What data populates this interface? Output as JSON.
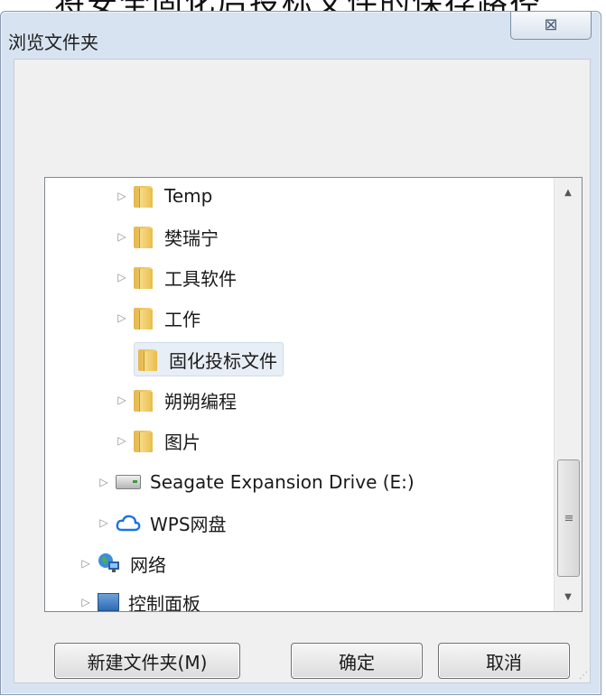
{
  "background_text": "将安全固化后投标文件的保存路径",
  "dialog": {
    "title": "浏览文件夹",
    "close_symbol": "⊠"
  },
  "tree": {
    "items": [
      {
        "label": "Temp",
        "expander": "▷",
        "icon": "folder-icon"
      },
      {
        "label": "樊瑞宁",
        "expander": "▷",
        "icon": "folder-icon"
      },
      {
        "label": "工具软件",
        "expander": "▷",
        "icon": "folder-icon"
      },
      {
        "label": "工作",
        "expander": "▷",
        "icon": "folder-icon"
      },
      {
        "label": "固化投标文件",
        "expander": "",
        "icon": "folder-icon",
        "selected": true
      },
      {
        "label": "朔朔编程",
        "expander": "▷",
        "icon": "folder-icon"
      },
      {
        "label": "图片",
        "expander": "▷",
        "icon": "folder-icon"
      },
      {
        "label": "Seagate Expansion Drive (E:)",
        "expander": "▷",
        "icon": "drive-icon"
      },
      {
        "label": "WPS网盘",
        "expander": "▷",
        "icon": "cloud-icon"
      },
      {
        "label": "网络",
        "expander": "▷",
        "icon": "network-icon"
      },
      {
        "label": "控制面板",
        "expander": "▷",
        "icon": "control-panel-icon"
      }
    ],
    "scroll_up": "▲",
    "scroll_down": "▼",
    "scroll_grip": "≡"
  },
  "buttons": {
    "new_folder": "新建文件夹(M)",
    "ok": "确定",
    "cancel": "取消"
  },
  "colors": {
    "frame": "#d7e3f1",
    "selection": "#e8eef6",
    "folder": "#e9bd4c",
    "cloud": "#1a73e8"
  }
}
